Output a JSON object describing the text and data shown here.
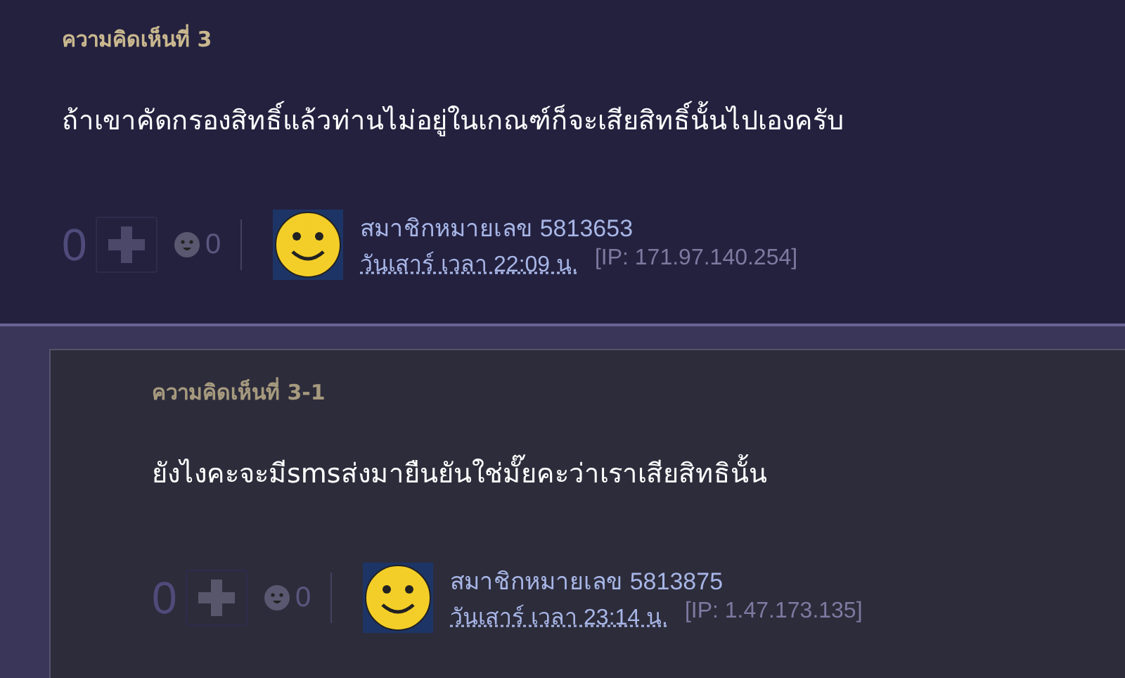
{
  "comments": [
    {
      "heading": "ความคิดเห็นที่ 3",
      "body": "ถ้าเขาคัดกรองสิทธิ์แล้วท่านไม่อยู่ในเกณฑ์ก็จะเสียสิทธิ์นั้นไปเองครับ",
      "votes": "0",
      "emotions": "0",
      "member": "สมาชิกหมายเลข 5813653",
      "time": "วันเสาร์ เวลา 22:09 น.",
      "ip": "[IP: 171.97.140.254]",
      "kind": "comment"
    },
    {
      "heading": "ความคิดเห็นที่ 3-1",
      "body": "ยังไงคะจะมีsmsส่งมายืนยันใช่มั๊ยคะว่าเราเสียสิทธินั้น",
      "votes": "0",
      "emotions": "0",
      "member": "สมาชิกหมายเลข 5813875",
      "time": "วันเสาร์ เวลา 23:14 น.",
      "ip": "[IP: 1.47.173.135]",
      "kind": "reply"
    }
  ]
}
